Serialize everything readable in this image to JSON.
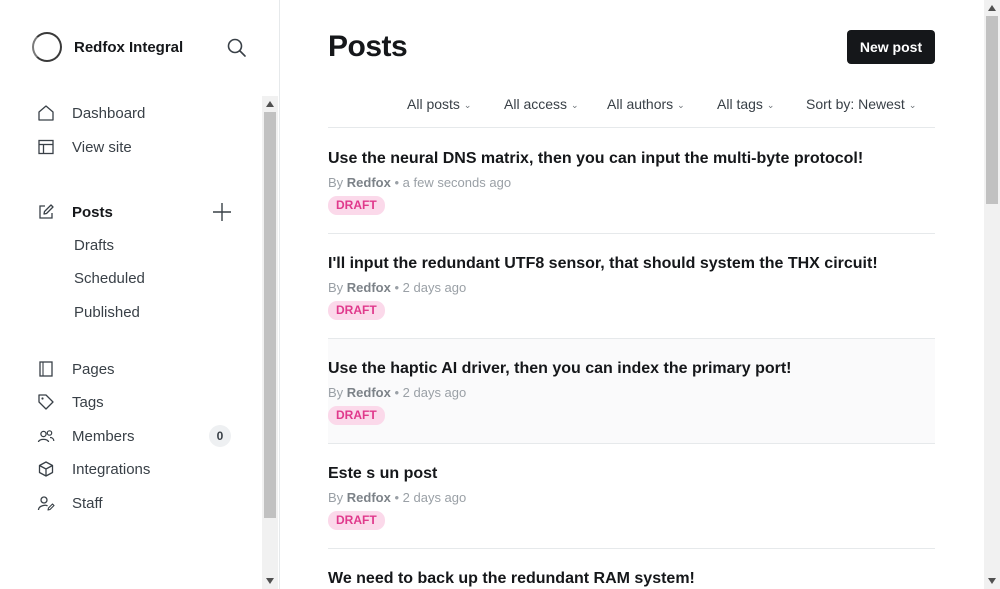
{
  "brand": {
    "name": "Redfox Integral"
  },
  "icons": {
    "search": "search-icon",
    "plus": "plus-icon"
  },
  "nav": {
    "dashboard": "Dashboard",
    "view_site": "View site",
    "posts": "Posts",
    "drafts": "Drafts",
    "scheduled": "Scheduled",
    "published": "Published",
    "pages": "Pages",
    "tags": "Tags",
    "members": "Members",
    "members_count": "0",
    "integrations": "Integrations",
    "staff": "Staff"
  },
  "main": {
    "title": "Posts",
    "new_post_label": "New post",
    "filters": {
      "type": "All posts",
      "access": "All access",
      "authors": "All authors",
      "tags": "All tags",
      "sort": "Sort by: Newest"
    },
    "posts": [
      {
        "title": "Use the neural DNS matrix, then you can input the multi-byte protocol!",
        "by": "By",
        "author": "Redfox",
        "time": "• a few seconds ago",
        "status": "DRAFT"
      },
      {
        "title": "I'll input the redundant UTF8 sensor, that should system the THX circuit!",
        "by": "By",
        "author": "Redfox",
        "time": "• 2 days ago",
        "status": "DRAFT"
      },
      {
        "title": "Use the haptic AI driver, then you can index the primary port!",
        "by": "By",
        "author": "Redfox",
        "time": "• 2 days ago",
        "status": "DRAFT"
      },
      {
        "title": "Este s un post",
        "by": "By",
        "author": "Redfox",
        "time": "• 2 days ago",
        "status": "DRAFT"
      },
      {
        "title": "We need to back up the redundant RAM system!"
      }
    ]
  },
  "colors": {
    "accent_dark": "#15171a",
    "draft_bg": "#fbd9ea",
    "draft_text": "#e0398c"
  }
}
